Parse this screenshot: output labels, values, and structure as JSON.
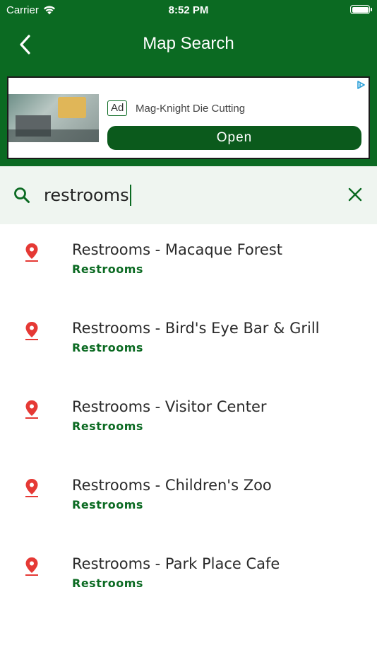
{
  "status_bar": {
    "carrier": "Carrier",
    "time": "8:52 PM"
  },
  "nav": {
    "title": "Map Search"
  },
  "ad": {
    "badge": "Ad",
    "advertiser": "Mag-Knight Die Cutting",
    "cta": "Open"
  },
  "search": {
    "query": "restrooms"
  },
  "results": [
    {
      "title": "Restrooms - Macaque Forest",
      "category": "Restrooms"
    },
    {
      "title": "Restrooms - Bird's Eye Bar & Grill",
      "category": "Restrooms"
    },
    {
      "title": "Restrooms - Visitor Center",
      "category": "Restrooms"
    },
    {
      "title": "Restrooms - Children's Zoo",
      "category": "Restrooms"
    },
    {
      "title": "Restrooms - Park Place Cafe",
      "category": "Restrooms"
    }
  ],
  "colors": {
    "brand_green": "#0b6a22",
    "pin_red": "#e53935",
    "search_bg": "#eff5f0"
  },
  "icons": {
    "back": "chevron-left-icon",
    "search": "search-icon",
    "clear": "close-icon",
    "result": "location-pin-icon"
  }
}
